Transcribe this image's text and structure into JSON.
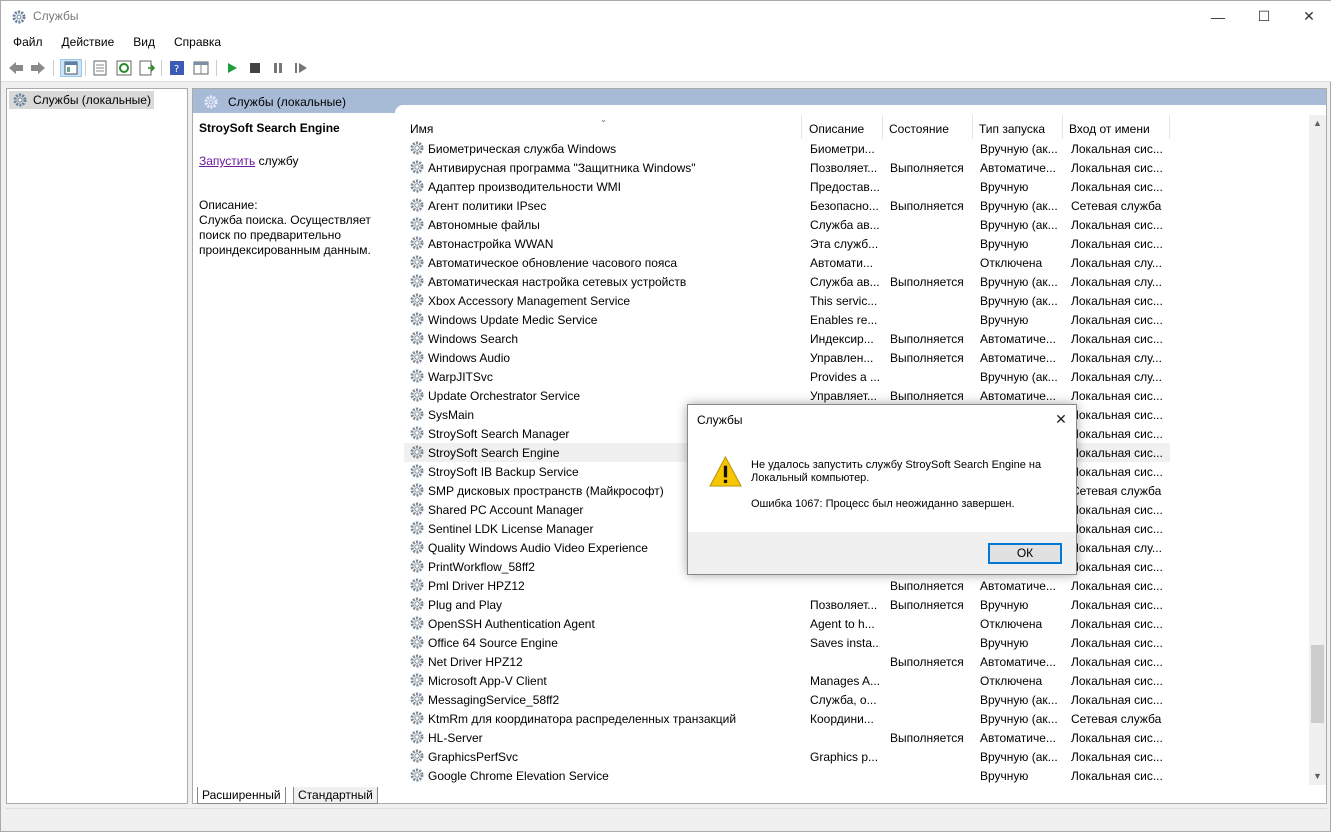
{
  "window": {
    "title": "Службы",
    "minimize": "—",
    "maximize": "☐",
    "close": "✕"
  },
  "menu": [
    "Файл",
    "Действие",
    "Вид",
    "Справка"
  ],
  "tree": {
    "root_label": "Службы (локальные)"
  },
  "panel": {
    "header": "Службы (локальные)",
    "selected_title": "StroySoft Search Engine",
    "start_link": "Запустить",
    "start_suffix": " службу",
    "description_label": "Описание:",
    "description_text": "Служба поиска. Осуществляет поиск по предварительно проиндексированным данным."
  },
  "columns": [
    "Имя",
    "Описание",
    "Состояние",
    "Тип запуска",
    "Вход от имени"
  ],
  "rows": [
    [
      "Биометрическая служба Windows",
      "Биометри...",
      "",
      "Вручную (ак...",
      "Локальная сис..."
    ],
    [
      "Антивирусная программа \"Защитника Windows\"",
      "Позволяет...",
      "Выполняется",
      "Автоматиче...",
      "Локальная сис..."
    ],
    [
      "Адаптер производительности WMI",
      "Предостав...",
      "",
      "Вручную",
      "Локальная сис..."
    ],
    [
      "Агент политики IPsec",
      "Безопасно...",
      "Выполняется",
      "Вручную (ак...",
      "Сетевая служба"
    ],
    [
      "Автономные файлы",
      "Служба ав...",
      "",
      "Вручную (ак...",
      "Локальная сис..."
    ],
    [
      "Автонастройка WWAN",
      "Эта служб...",
      "",
      "Вручную",
      "Локальная сис..."
    ],
    [
      "Автоматическое обновление часового пояса",
      "Автомати...",
      "",
      "Отключена",
      "Локальная слу..."
    ],
    [
      "Автоматическая настройка сетевых устройств",
      "Служба ав...",
      "Выполняется",
      "Вручную (ак...",
      "Локальная слу..."
    ],
    [
      "Xbox Accessory Management Service",
      "This servic...",
      "",
      "Вручную (ак...",
      "Локальная сис..."
    ],
    [
      "Windows Update Medic Service",
      "Enables re...",
      "",
      "Вручную",
      "Локальная сис..."
    ],
    [
      "Windows Search",
      "Индексир...",
      "Выполняется",
      "Автоматиче...",
      "Локальная сис..."
    ],
    [
      "Windows Audio",
      "Управлен...",
      "Выполняется",
      "Автоматиче...",
      "Локальная слу..."
    ],
    [
      "WarpJITSvc",
      "Provides a ...",
      "",
      "Вручную (ак...",
      "Локальная слу..."
    ],
    [
      "Update Orchestrator Service",
      "Управляет...",
      "Выполняется",
      "Автоматиче...",
      "Локальная сис..."
    ],
    [
      "SysMain",
      "",
      "",
      "",
      "Локальная сис..."
    ],
    [
      "StroySoft Search Manager",
      "",
      "",
      "",
      "Локальная сис..."
    ],
    [
      "StroySoft Search Engine",
      "",
      "",
      "",
      "Локальная сис..."
    ],
    [
      "StroySoft IB Backup Service",
      "",
      "",
      "",
      "Локальная сис..."
    ],
    [
      "SMP дисковых пространств (Майкрософт)",
      "",
      "",
      "",
      "Сетевая служба"
    ],
    [
      "Shared PC Account Manager",
      "",
      "",
      "",
      "Локальная сис..."
    ],
    [
      "Sentinel LDK License Manager",
      "",
      "",
      "",
      "Локальная сис..."
    ],
    [
      "Quality Windows Audio Video Experience",
      "",
      "",
      "",
      "Локальная слу..."
    ],
    [
      "PrintWorkflow_58ff2",
      "",
      "",
      "",
      "Локальная сис..."
    ],
    [
      "Pml Driver HPZ12",
      "",
      "Выполняется",
      "Автоматиче...",
      "Локальная сис..."
    ],
    [
      "Plug and Play",
      "Позволяет...",
      "Выполняется",
      "Вручную",
      "Локальная сис..."
    ],
    [
      "OpenSSH Authentication Agent",
      "Agent to h...",
      "",
      "Отключена",
      "Локальная сис..."
    ],
    [
      "Office 64 Source Engine",
      "Saves insta...",
      "",
      "Вручную",
      "Локальная сис..."
    ],
    [
      "Net Driver HPZ12",
      "",
      "Выполняется",
      "Автоматиче...",
      "Локальная сис..."
    ],
    [
      "Microsoft App-V Client",
      "Manages A...",
      "",
      "Отключена",
      "Локальная сис..."
    ],
    [
      "MessagingService_58ff2",
      "Служба, о...",
      "",
      "Вручную (ак...",
      "Локальная сис..."
    ],
    [
      "KtmRm для координатора распределенных транзакций",
      "Координи...",
      "",
      "Вручную (ак...",
      "Сетевая служба"
    ],
    [
      "HL-Server",
      "",
      "Выполняется",
      "Автоматиче...",
      "Локальная сис..."
    ],
    [
      "GraphicsPerfSvc",
      "Graphics p...",
      "",
      "Вручную (ак...",
      "Локальная сис..."
    ],
    [
      "Google Chrome Elevation Service",
      "",
      "",
      "Вручную",
      "Локальная сис..."
    ]
  ],
  "selected_row": 16,
  "tabs": {
    "extended": "Расширенный",
    "standard": "Стандартный"
  },
  "dialog": {
    "title": "Службы",
    "message": "Не удалось запустить службу StroySoft Search Engine на Локальный компьютер.",
    "error": "Ошибка 1067: Процесс был неожиданно завершен.",
    "ok": "ОК"
  }
}
